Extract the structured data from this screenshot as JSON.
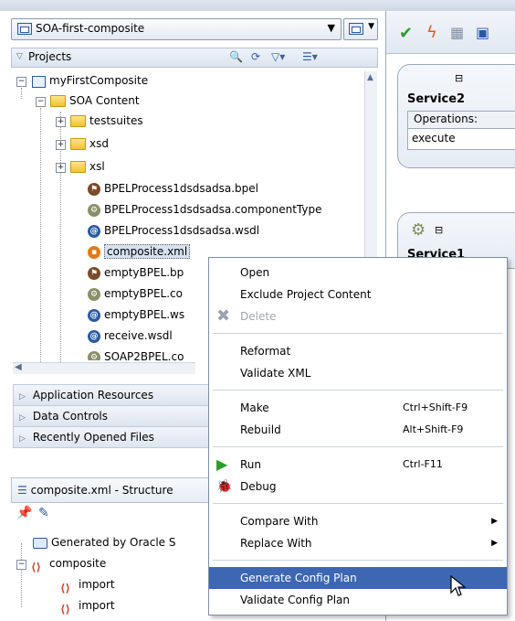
{
  "app_selector": {
    "label": "SOA-first-composite"
  },
  "projects_panel": {
    "title": "Projects"
  },
  "tree": {
    "root": "myFirstComposite",
    "soa_content": "SOA Content",
    "items": [
      {
        "label": "testsuites"
      },
      {
        "label": "xsd"
      },
      {
        "label": "xsl"
      },
      {
        "label": "BPELProcess1dsdsadsa.bpel"
      },
      {
        "label": "BPELProcess1dsdsadsa.componentType"
      },
      {
        "label": "BPELProcess1dsdsadsa.wsdl"
      },
      {
        "label": "composite.xml"
      },
      {
        "label": "emptyBPEL.bp"
      },
      {
        "label": "emptyBPEL.co"
      },
      {
        "label": "emptyBPEL.ws"
      },
      {
        "label": "receive.wsdl"
      },
      {
        "label": "SOAP2BPEL.co"
      }
    ]
  },
  "accordions": {
    "app_resources": "Application Resources",
    "data_controls": "Data Controls",
    "recent_files": "Recently Opened Files"
  },
  "structure": {
    "title": "composite.xml - Structure",
    "generated": "Generated by Oracle S",
    "composite": "composite",
    "import1": "import",
    "import2": "import"
  },
  "canvas": {
    "service2": {
      "title": "Service2",
      "operations_label": "Operations:",
      "operation": "execute"
    },
    "service1": {
      "title": "Service1"
    }
  },
  "context_menu": {
    "open": "Open",
    "exclude": "Exclude Project Content",
    "delete": "Delete",
    "reformat": "Reformat",
    "validate_xml": "Validate XML",
    "make": "Make",
    "make_shortcut": "Ctrl+Shift-F9",
    "rebuild": "Rebuild",
    "rebuild_shortcut": "Alt+Shift-F9",
    "run": "Run",
    "run_shortcut": "Ctrl-F11",
    "debug": "Debug",
    "compare_with": "Compare With",
    "replace_with": "Replace With",
    "generate_config_plan": "Generate Config Plan",
    "validate_config_plan": "Validate Config Plan"
  }
}
